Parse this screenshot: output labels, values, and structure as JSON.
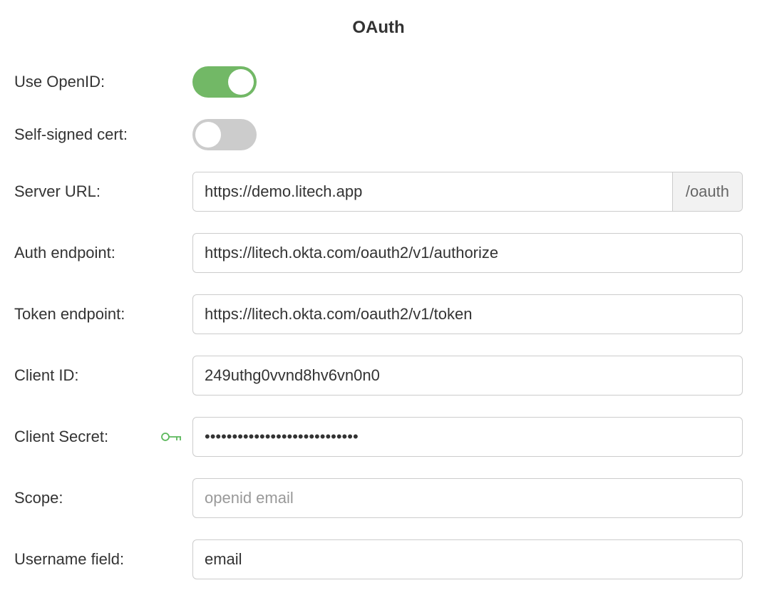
{
  "title": "OAuth",
  "fields": {
    "use_openid": {
      "label": "Use OpenID:",
      "value": true
    },
    "self_signed": {
      "label": "Self-signed cert:",
      "value": false
    },
    "server_url": {
      "label": "Server URL:",
      "value": "https://demo.litech.app",
      "suffix": "/oauth"
    },
    "auth_endpoint": {
      "label": "Auth endpoint:",
      "value": "https://litech.okta.com/oauth2/v1/authorize"
    },
    "token_endpoint": {
      "label": "Token endpoint:",
      "value": "https://litech.okta.com/oauth2/v1/token"
    },
    "client_id": {
      "label": "Client ID:",
      "value": "249uthg0vvnd8hv6vn0n0"
    },
    "client_secret": {
      "label": "Client Secret:",
      "value": "••••••••••••••••••••••••••••"
    },
    "scope": {
      "label": "Scope:",
      "value": "",
      "placeholder": "openid email"
    },
    "username_field": {
      "label": "Username field:",
      "value": "email"
    }
  }
}
